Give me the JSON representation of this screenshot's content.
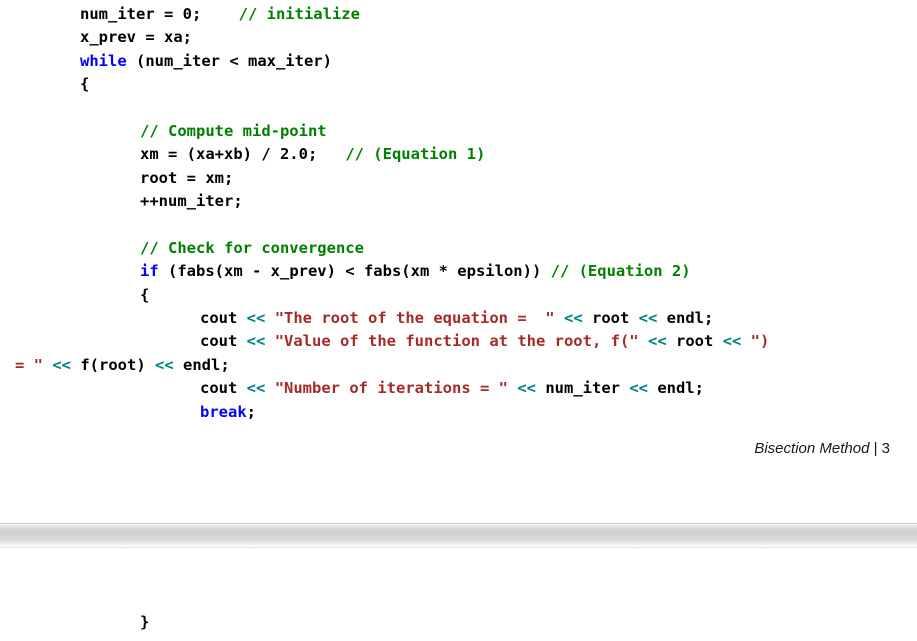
{
  "document": {
    "type": "word-processor-page-view",
    "footer": {
      "title": "Bisection Method",
      "separator": " | ",
      "page_number": "3"
    }
  },
  "colors": {
    "keyword": "#0000FF",
    "comment": "#008000",
    "string": "#A52A2A",
    "operator": "#008080",
    "plain": "#000000",
    "page_background": "#FFFFFF",
    "page_break": "#CFCFCF"
  },
  "code_page_one": {
    "lines": [
      {
        "indent": "ind1",
        "tokens": [
          {
            "t": "num_iter = 0;    ",
            "c": "tok-plain"
          },
          {
            "t": "// initialize",
            "c": "tok-comment"
          }
        ]
      },
      {
        "indent": "ind1",
        "tokens": [
          {
            "t": "x_prev = xa;",
            "c": "tok-plain"
          }
        ]
      },
      {
        "indent": "ind1",
        "tokens": [
          {
            "t": "while",
            "c": "tok-kw"
          },
          {
            "t": " (num_iter < max_iter)",
            "c": "tok-plain"
          }
        ]
      },
      {
        "indent": "ind1",
        "tokens": [
          {
            "t": "{",
            "c": "tok-plain"
          }
        ]
      },
      {
        "indent": "ind2",
        "tokens": [
          {
            "t": "",
            "c": "tok-plain"
          }
        ]
      },
      {
        "indent": "ind2",
        "tokens": [
          {
            "t": "// Compute mid-point",
            "c": "tok-comment"
          }
        ]
      },
      {
        "indent": "ind2",
        "tokens": [
          {
            "t": "xm = (xa+xb) / 2.0;   ",
            "c": "tok-plain"
          },
          {
            "t": "// (Equation 1)",
            "c": "tok-comment"
          }
        ]
      },
      {
        "indent": "ind2",
        "tokens": [
          {
            "t": "root = xm;",
            "c": "tok-plain"
          }
        ]
      },
      {
        "indent": "ind2",
        "tokens": [
          {
            "t": "++num_iter;",
            "c": "tok-plain"
          }
        ]
      },
      {
        "indent": "ind2",
        "tokens": [
          {
            "t": "",
            "c": "tok-plain"
          }
        ]
      },
      {
        "indent": "ind2",
        "tokens": [
          {
            "t": "// Check for convergence",
            "c": "tok-comment"
          }
        ]
      },
      {
        "indent": "ind2",
        "tokens": [
          {
            "t": "if",
            "c": "tok-kw"
          },
          {
            "t": " (fabs(xm - x_prev) < fabs(xm * epsilon)) ",
            "c": "tok-plain"
          },
          {
            "t": "// (Equation 2)",
            "c": "tok-comment"
          }
        ]
      },
      {
        "indent": "ind2",
        "tokens": [
          {
            "t": "{",
            "c": "tok-plain"
          }
        ]
      },
      {
        "indent": "ind3",
        "tokens": [
          {
            "t": "cout ",
            "c": "tok-plain"
          },
          {
            "t": "<<",
            "c": "tok-op"
          },
          {
            "t": " ",
            "c": "tok-plain"
          },
          {
            "t": "\"The root of the equation =  \"",
            "c": "tok-string"
          },
          {
            "t": " ",
            "c": "tok-plain"
          },
          {
            "t": "<<",
            "c": "tok-op"
          },
          {
            "t": " root ",
            "c": "tok-plain"
          },
          {
            "t": "<<",
            "c": "tok-op"
          },
          {
            "t": " endl;",
            "c": "tok-plain"
          }
        ]
      },
      {
        "indent": "ind3",
        "tokens": [
          {
            "t": "cout ",
            "c": "tok-plain"
          },
          {
            "t": "<<",
            "c": "tok-op"
          },
          {
            "t": " ",
            "c": "tok-plain"
          },
          {
            "t": "\"Value of the function at the root, f(\"",
            "c": "tok-string"
          },
          {
            "t": " ",
            "c": "tok-plain"
          },
          {
            "t": "<<",
            "c": "tok-op"
          },
          {
            "t": " root ",
            "c": "tok-plain"
          },
          {
            "t": "<<",
            "c": "tok-op"
          },
          {
            "t": " ",
            "c": "tok-plain"
          },
          {
            "t": "\")",
            "c": "tok-string"
          }
        ]
      },
      {
        "indent": "ind0",
        "tokens": [
          {
            "t": "= \"",
            "c": "tok-string"
          },
          {
            "t": " ",
            "c": "tok-plain"
          },
          {
            "t": "<<",
            "c": "tok-op"
          },
          {
            "t": " f(root) ",
            "c": "tok-plain"
          },
          {
            "t": "<<",
            "c": "tok-op"
          },
          {
            "t": " endl;",
            "c": "tok-plain"
          }
        ]
      },
      {
        "indent": "ind3",
        "tokens": [
          {
            "t": "cout ",
            "c": "tok-plain"
          },
          {
            "t": "<<",
            "c": "tok-op"
          },
          {
            "t": " ",
            "c": "tok-plain"
          },
          {
            "t": "\"Number of iterations = \"",
            "c": "tok-string"
          },
          {
            "t": " ",
            "c": "tok-plain"
          },
          {
            "t": "<<",
            "c": "tok-op"
          },
          {
            "t": " num_iter ",
            "c": "tok-plain"
          },
          {
            "t": "<<",
            "c": "tok-op"
          },
          {
            "t": " endl;",
            "c": "tok-plain"
          }
        ]
      },
      {
        "indent": "ind3",
        "tokens": [
          {
            "t": "break",
            "c": "tok-kw"
          },
          {
            "t": ";",
            "c": "tok-plain"
          }
        ]
      }
    ]
  },
  "code_page_two": {
    "lines": [
      {
        "indent": "ind2",
        "tokens": [
          {
            "t": "}",
            "c": "tok-plain"
          }
        ]
      }
    ]
  }
}
